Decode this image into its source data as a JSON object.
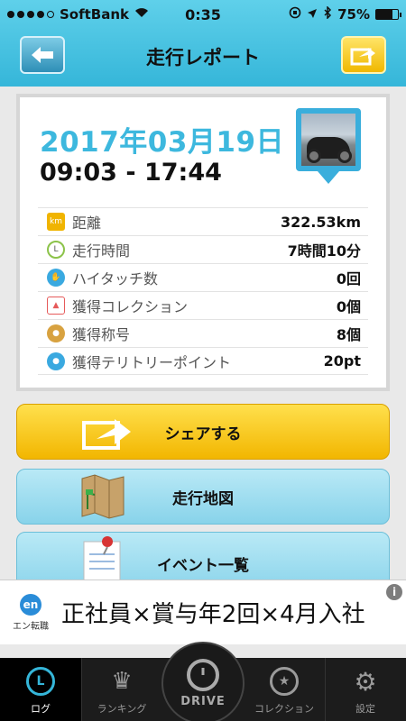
{
  "status": {
    "carrier": "SoftBank",
    "time": "0:35",
    "battery": "75%",
    "battery_level": 0.75
  },
  "nav": {
    "title": "走行レポート",
    "back_icon": "arrow-left-icon",
    "share_icon": "share-icon"
  },
  "report": {
    "date": "2017年03月19日",
    "time_range": "09:03 - 17:44",
    "stats": [
      {
        "icon": "distance-icon",
        "label": "距離",
        "value": "322.53km",
        "color": "#f0b400"
      },
      {
        "icon": "clock-icon",
        "label": "走行時間",
        "value": "7時間10分",
        "color": "#8cc34a"
      },
      {
        "icon": "high-five-icon",
        "label": "ハイタッチ数",
        "value": "0回",
        "color": "#3aa9e0"
      },
      {
        "icon": "collection-icon",
        "label": "獲得コレクション",
        "value": "0個",
        "color": "#e65a5a"
      },
      {
        "icon": "title-badge-icon",
        "label": "獲得称号",
        "value": "8個",
        "color": "#d8a240"
      },
      {
        "icon": "territory-icon",
        "label": "獲得テリトリーポイント",
        "value": "20pt",
        "color": "#3aa9e0"
      }
    ]
  },
  "actions": {
    "share_label": "シェアする",
    "map_label": "走行地図",
    "event_label": "イベント一覧"
  },
  "ad": {
    "logo_mark": "en",
    "logo_text": "エン転職",
    "text": "正社員×賞与年2回×4月入社",
    "info": "i"
  },
  "tabs": [
    {
      "label": "ログ",
      "icon": "log-clock-icon",
      "glyph": "L",
      "active": true
    },
    {
      "label": "ランキング",
      "icon": "trophy-icon",
      "glyph": "♛",
      "active": false
    },
    {
      "label": "DRIVE",
      "icon": "power-icon",
      "active": false
    },
    {
      "label": "コレクション",
      "icon": "star-icon",
      "glyph": "★",
      "active": false
    },
    {
      "label": "設定",
      "icon": "gear-icon",
      "glyph": "⚙",
      "active": false
    }
  ]
}
